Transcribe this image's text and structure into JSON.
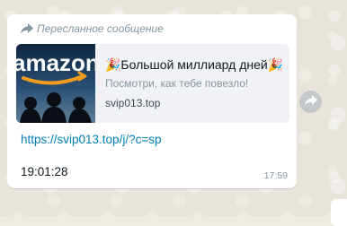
{
  "message": {
    "forwarded_label": "Пересланное сообщение",
    "preview": {
      "title": "🎉Большой миллиард дней🎉",
      "description": "Посмотри, как тебе повезло!",
      "domain": "svip013.top",
      "thumbnail_text": "amazon"
    },
    "link": "https://svip013.top/j/?c=sp",
    "text": "19:01:28",
    "time": "17:59"
  },
  "icons": {
    "forwarded": "forwarded-arrow-icon",
    "share": "share-arrow-icon"
  },
  "colors": {
    "background": "#efeae2",
    "bubble": "#ffffff",
    "link": "#027eb5",
    "meta": "#8696a0"
  }
}
